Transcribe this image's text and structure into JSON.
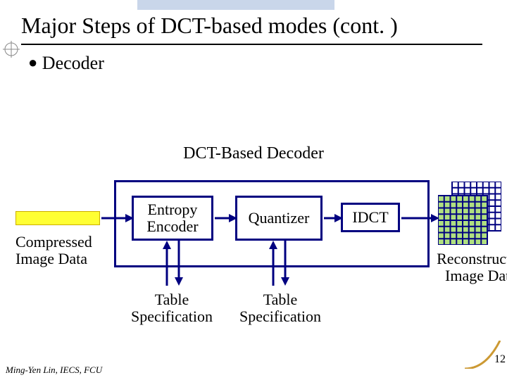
{
  "title": "Major Steps of DCT-based modes (cont. )",
  "bullet": "Decoder",
  "subtitle": "DCT-Based Decoder",
  "blocks": {
    "entropy": "Entropy Encoder",
    "quantizer": "Quantizer",
    "idct": "IDCT"
  },
  "left_label": "Compressed Image Data",
  "right_label": "Reconstructed Image Data",
  "tablespec": "Table Specification",
  "footer": "Ming-Yen Lin, IECS, FCU",
  "page": "12"
}
